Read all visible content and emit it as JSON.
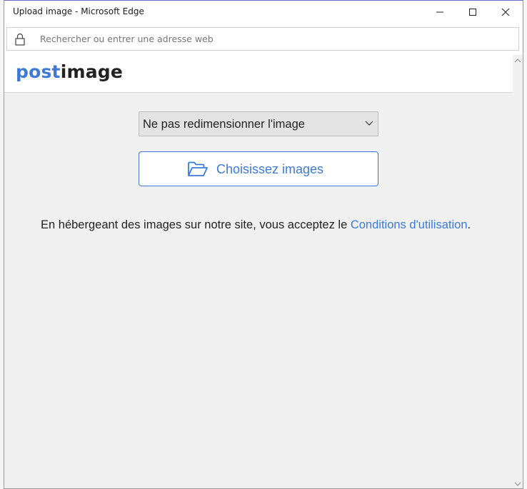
{
  "window": {
    "title": "Upload image - Microsoft Edge"
  },
  "address_bar": {
    "placeholder": "Rechercher ou entrer une adresse web"
  },
  "header": {
    "logo_part1": "post",
    "logo_part2": "image"
  },
  "resize": {
    "selected": "Ne pas redimensionner l'image"
  },
  "upload": {
    "button_label": "Choisissez images"
  },
  "terms": {
    "text": "En hébergeant des images sur notre site, vous acceptez le ",
    "link_label": "Conditions d'utilisation",
    "trailing": "."
  },
  "colors": {
    "accent": "#3d7ad7",
    "page_bg": "#f0f0f0"
  },
  "icons": [
    "lock-icon",
    "minimize-icon",
    "maximize-icon",
    "close-icon",
    "chevron-down-icon",
    "folder-open-icon"
  ]
}
